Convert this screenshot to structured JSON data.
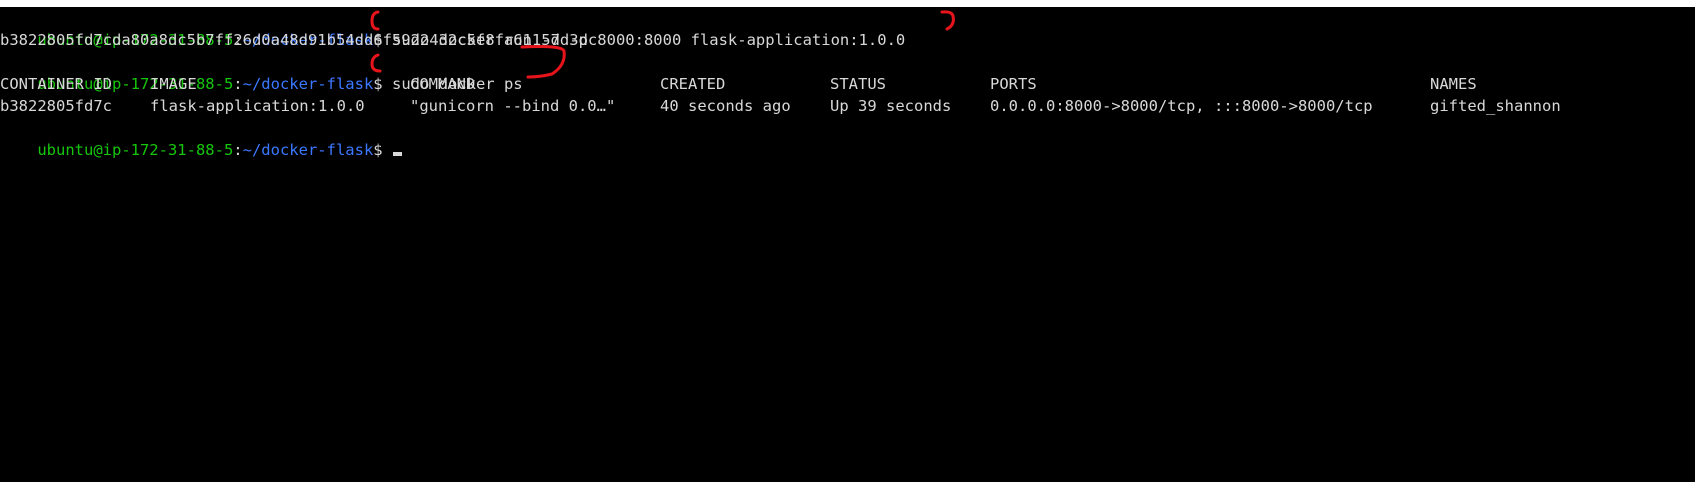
{
  "prompt": {
    "user_host": "ubuntu@ip-172-31-88-5",
    "separator": ":",
    "path": "~/docker-flask",
    "symbol": "$"
  },
  "commands": [
    "sudo docker run -d -p 8000:8000 flask-application:1.0.0",
    "sudo docker ps"
  ],
  "run_output": "b3822805fd7cda80a8dc5b7ff26d0a48d91b54dd6f5922432c5f8fa61157d3dc",
  "ps_table": {
    "headers": [
      "CONTAINER ID",
      "IMAGE",
      "COMMAND",
      "CREATED",
      "STATUS",
      "PORTS",
      "NAMES"
    ],
    "rows": [
      [
        "b3822805fd7c",
        "flask-application:1.0.0",
        "\"gunicorn --bind 0.0…\"",
        "40 seconds ago",
        "Up 39 seconds",
        "0.0.0.0:8000->8000/tcp, :::8000->8000/tcp",
        "gifted_shannon"
      ]
    ]
  },
  "colors": {
    "background": "#000000",
    "text": "#d8d8d8",
    "user_host": "#16c60c",
    "path": "#3b78ff",
    "annotation": "#e8141c"
  }
}
